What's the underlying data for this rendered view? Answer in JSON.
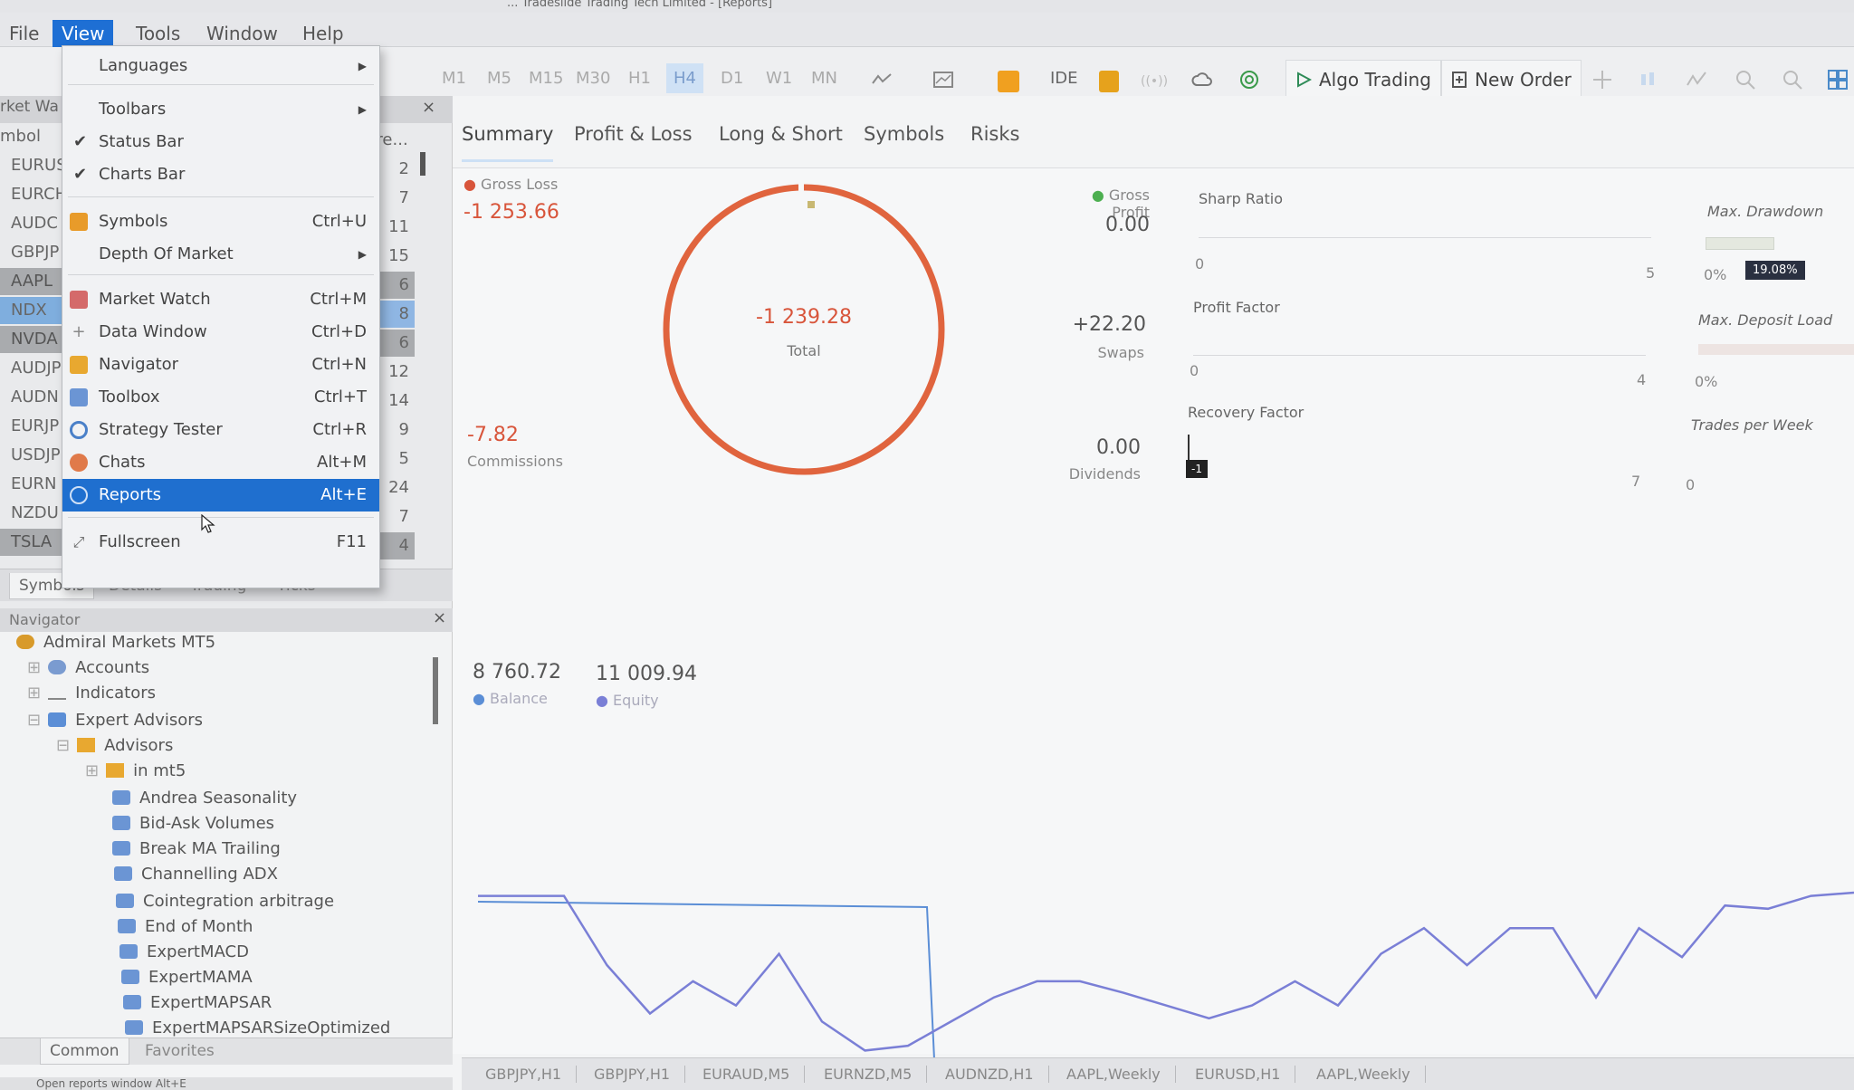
{
  "window": {
    "title": "... Tradeslide Trading Tech Limited - [Reports]"
  },
  "menubar": {
    "file": "File",
    "view": "View",
    "tools": "Tools",
    "window": "Window",
    "help": "Help"
  },
  "toolbar": {
    "timeframes": [
      "M1",
      "M5",
      "M15",
      "M30",
      "H1",
      "H4",
      "D1",
      "W1",
      "MN"
    ],
    "selected_timeframe": "H4",
    "ide": "IDE",
    "algo_trading": "Algo Trading",
    "new_order": "New Order"
  },
  "market_watch": {
    "title": "rket Wa",
    "col_symbol": "mbol",
    "col_spread": "pre...",
    "symbols": [
      "EURUS",
      "EURCH",
      "AUDC",
      "GBPJP",
      "AAPL",
      "NDX",
      "NVDA",
      "AUDJP",
      "AUDN",
      "EURJP",
      "USDJP",
      "EURN",
      "NZDU",
      "TSLA"
    ],
    "spreads": [
      "2",
      "7",
      "11",
      "15",
      "6",
      "8",
      "6",
      "12",
      "14",
      "9",
      "5",
      "24",
      "7",
      "4"
    ],
    "tabs": [
      "Symbols",
      "Details",
      "Trading",
      "Ticks"
    ]
  },
  "view_menu": {
    "languages": "Languages",
    "toolbars": "Toolbars",
    "status_bar": "Status Bar",
    "charts_bar": "Charts Bar",
    "symbols": "Symbols",
    "symbols_sc": "Ctrl+U",
    "depth": "Depth Of Market",
    "market_watch": "Market Watch",
    "market_watch_sc": "Ctrl+M",
    "data_window": "Data Window",
    "data_window_sc": "Ctrl+D",
    "navigator": "Navigator",
    "navigator_sc": "Ctrl+N",
    "toolbox": "Toolbox",
    "toolbox_sc": "Ctrl+T",
    "strategy_tester": "Strategy Tester",
    "strategy_tester_sc": "Ctrl+R",
    "chats": "Chats",
    "chats_sc": "Alt+M",
    "reports": "Reports",
    "reports_sc": "Alt+E",
    "fullscreen": "Fullscreen",
    "fullscreen_sc": "F11"
  },
  "navigator": {
    "title": "Navigator",
    "root": "Admiral Markets MT5",
    "accounts": "Accounts",
    "indicators": "Indicators",
    "expert_advisors": "Expert Advisors",
    "advisors": "Advisors",
    "in_mt5": "in mt5",
    "experts": [
      "Andrea Seasonality",
      "Bid-Ask Volumes",
      "Break MA Trailing",
      "Channelling ADX",
      "Cointegration arbitrage",
      "End of Month",
      "ExpertMACD",
      "ExpertMAMA",
      "ExpertMAPSAR",
      "ExpertMAPSARSizeOptimized"
    ],
    "tabs": [
      "Common",
      "Favorites"
    ]
  },
  "reports": {
    "tabs": [
      "Summary",
      "Profit & Loss",
      "Long & Short",
      "Symbols",
      "Risks"
    ],
    "gross_loss_label": "Gross Loss",
    "gross_loss": "-1 253.66",
    "total": "-1 239.28",
    "total_label": "Total",
    "gross_profit_label": "Gross Profit",
    "gross_profit": "0.00",
    "swaps": "+22.20",
    "swaps_label": "Swaps",
    "commissions": "-7.82",
    "commissions_label": "Commissions",
    "dividends": "0.00",
    "dividends_label": "Dividends",
    "sharp_ratio": "Sharp Ratio",
    "sharp_min": "0",
    "sharp_max": "5",
    "profit_factor": "Profit Factor",
    "pf_min": "0",
    "pf_max": "4",
    "recovery_factor": "Recovery Factor",
    "rf_badge": "-1",
    "rf_max": "7",
    "max_drawdown": "Max. Drawdown",
    "dd_min": "0%",
    "dd_badge": "19.08%",
    "max_deposit_load": "Max. Deposit Load",
    "dl_min": "0%",
    "trades_per_week": "Trades per Week",
    "tpw_val": "0",
    "balance": "8 760.72",
    "balance_label": "Balance",
    "equity": "11 009.94",
    "equity_label": "Equity",
    "equity_series": [
      0.98,
      0.98,
      0.98,
      0.55,
      0.25,
      0.45,
      0.3,
      0.62,
      0.2,
      0.02,
      0.05,
      0.2,
      0.35,
      0.45,
      0.45,
      0.38,
      0.3,
      0.22,
      0.3,
      0.45,
      0.3,
      0.62,
      0.78,
      0.55,
      0.78,
      0.78,
      0.35,
      0.78,
      0.6,
      0.92,
      0.9,
      0.98,
      1.0
    ]
  },
  "bottom_tabs": [
    "GBPJPY,H1",
    "GBPJPY,H1",
    "EURAUD,M5",
    "EURNZD,M5",
    "AUDNZD,H1",
    "AAPL,Weekly",
    "EURUSD,H1",
    "AAPL,Weekly"
  ],
  "status": "Open reports window  Alt+E"
}
